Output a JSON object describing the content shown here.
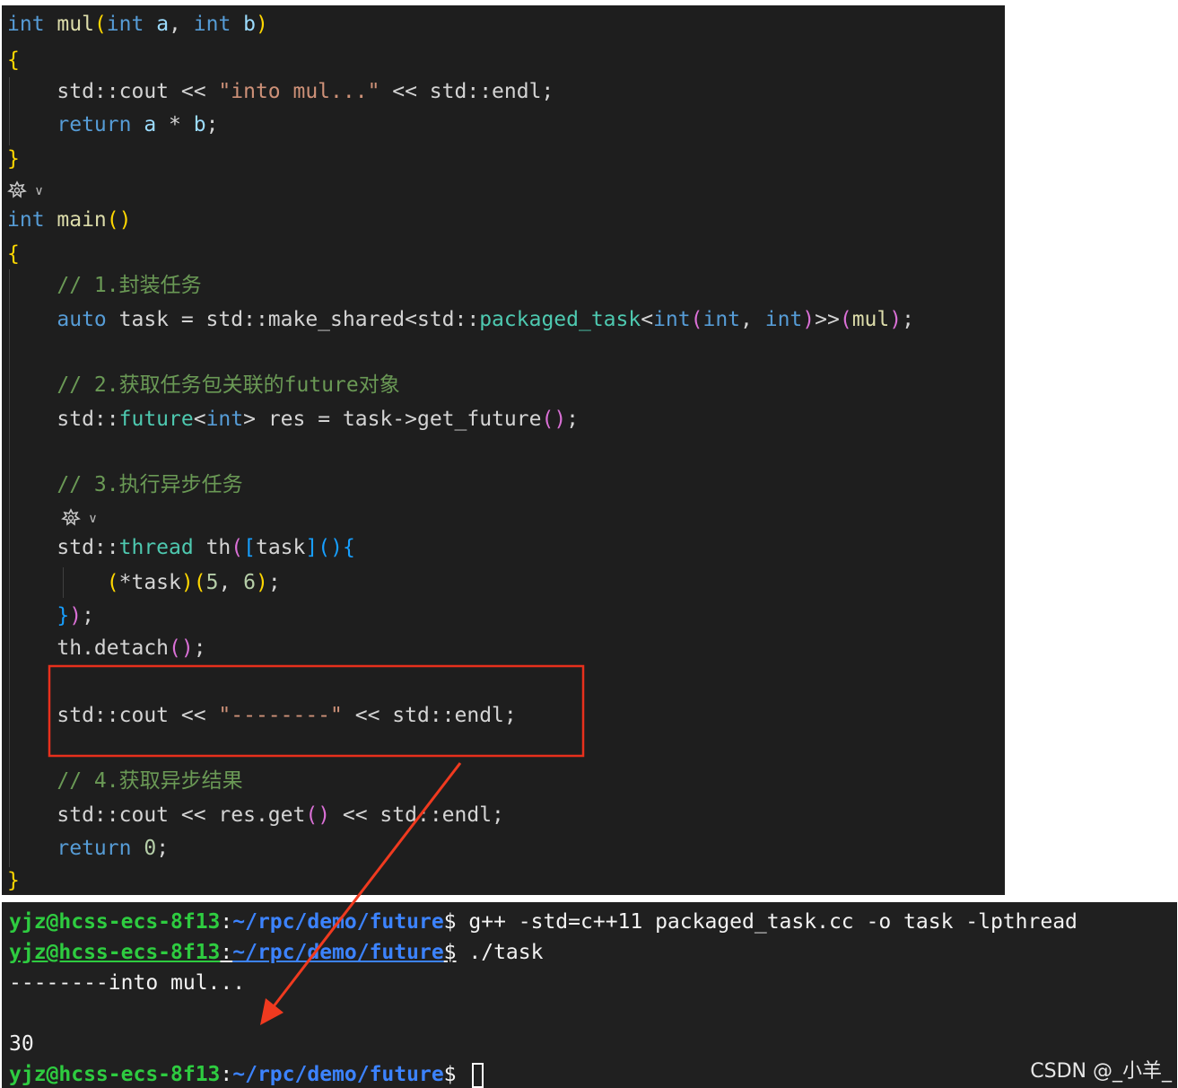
{
  "editor": {
    "code": {
      "l1_int": "int",
      "l1_name": " mul",
      "l1_paren_open": "(",
      "l1_int2": "int",
      "l1_a": " a",
      "l1_comma": ", ",
      "l1_int3": "int",
      "l1_b": " b",
      "l1_paren_close": ")",
      "brace_open": "{",
      "brace_close": "}",
      "l3_std": "    std::cout << ",
      "l3_str": "\"into mul...\"",
      "l3_rest": " << std::endl;",
      "l4_return": "    return",
      "l4_a": " a",
      "l4_op": " * ",
      "l4_b": "b",
      "l4_semi": ";",
      "main_int": "int",
      "main_name": " main",
      "main_parens": "()",
      "c1": "    // 1.封装任务",
      "task_auto": "    auto",
      "task_mid": " task = std::make_shared<std::",
      "task_pt": "packaged_task",
      "task_lt": "<",
      "task_int1": "int",
      "task_po": "(",
      "task_int2": "int",
      "task_comma": ", ",
      "task_int3": "int",
      "task_pc": ")",
      "task_gt": ">>",
      "task_call_o": "(",
      "task_mul": "mul",
      "task_call_c": ")",
      "task_semi": ";",
      "c2": "    // 2.获取任务包关联的future对象",
      "fut_std": "    std::",
      "fut_ty": "future",
      "fut_lt": "<",
      "fut_int": "int",
      "fut_rest": "> res = task->get_future",
      "fut_parens": "()",
      "fut_semi": ";",
      "c3": "    // 3.执行异步任务",
      "th_std": "    std::",
      "th_ty": "thread",
      "th_name": " th",
      "th_po": "(",
      "th_br": "[",
      "th_task": "task",
      "th_brc": "]",
      "th_pp": "()",
      "th_cb": "{",
      "call_indent": "        ",
      "call_po": "(",
      "call_inner": "*task",
      "call_pc": ")",
      "call_ao": "(",
      "call_5": "5",
      "call_comma": ", ",
      "call_6": "6",
      "call_ac": ")",
      "call_semi": ";",
      "close_indent": "    ",
      "close_cb": "}",
      "close_p": ")",
      "close_semi": ";",
      "det_text": "    th.detach",
      "det_parens": "()",
      "det_semi": ";",
      "dash_std": "    std::cout << ",
      "dash_str": "\"--------\"",
      "dash_rest": " << std::endl;",
      "c4": "    // 4.获取异步结果",
      "get_std": "    std::cout << res.get",
      "get_parens": "()",
      "get_rest": " << std::endl;",
      "ret0_kw": "    return",
      "ret0_sp": " ",
      "ret0_num": "0",
      "ret0_semi": ";"
    },
    "codelens_icon": "settings-icon"
  },
  "terminal": {
    "prompt_user": "yjz@hcss-ecs-8f13",
    "prompt_colon": ":",
    "prompt_path": "~/rpc/demo/future",
    "prompt_dollar": "$",
    "cmd1": " g++ -std=c++11 packaged_task.cc -o task -lpthread",
    "cmd2": " ./task",
    "out1": "--------into mul...",
    "out2": "",
    "out3": "30"
  },
  "watermark": "CSDN @_小羊_",
  "colors": {
    "editor_bg": "#1e1e1e",
    "terminal_bg": "#202020",
    "highlight_box": "#e8301c",
    "arrow": "#f03a1f"
  }
}
